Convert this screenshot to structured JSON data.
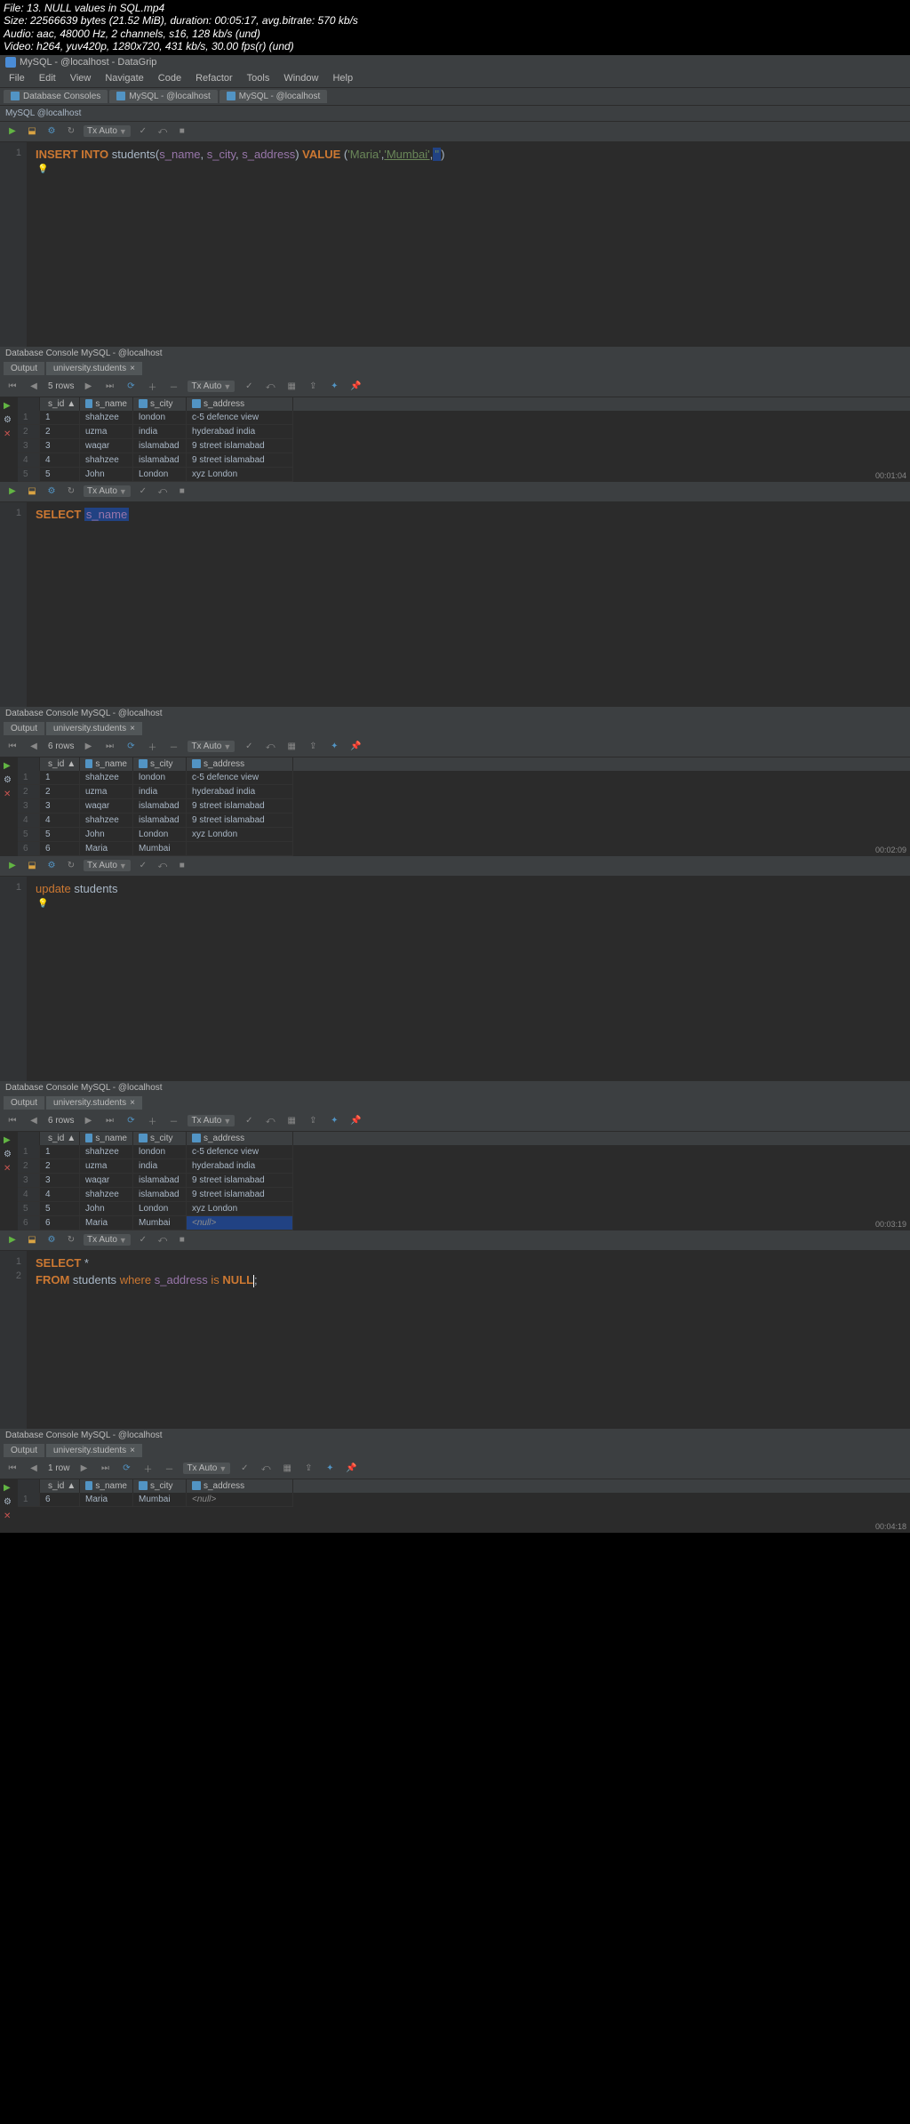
{
  "file_header": {
    "l1": "File: 13. NULL values in SQL.mp4",
    "l2": "Size: 22566639 bytes (21.52 MiB), duration: 00:05:17, avg.bitrate: 570 kb/s",
    "l3": "Audio: aac, 48000 Hz, 2 channels, s16, 128 kb/s (und)",
    "l4": "Video: h264, yuv420p, 1280x720, 431 kb/s, 30.00 fps(r) (und)"
  },
  "app": {
    "title": "MySQL - @localhost - DataGrip"
  },
  "menu": [
    "File",
    "Edit",
    "View",
    "Navigate",
    "Code",
    "Refactor",
    "Tools",
    "Window",
    "Help"
  ],
  "tabs": {
    "t1": "Database Consoles",
    "t2": "MySQL - @localhost",
    "t3": "MySQL - @localhost"
  },
  "breadcrumb": "MySQL  @localhost",
  "txauto": "Tx Auto",
  "frame1": {
    "ln": "1",
    "kw_insert": "INSERT",
    "kw_into": "INTO",
    "table": "students",
    "col1": "s_name",
    "col2": "s_city",
    "col3": "s_address",
    "kw_value": "VALUE",
    "v1": "'Maria'",
    "v2": "'Mumbai'",
    "v3": "''",
    "ts": "00:01:04"
  },
  "console_title": "Database Console MySQL - @localhost",
  "console_tabs": {
    "output": "Output",
    "result": "university.students"
  },
  "cols": {
    "id": "s_id",
    "name": "s_name",
    "city": "s_city",
    "addr": "s_address"
  },
  "result1": {
    "rows_label": "5 rows",
    "rows": [
      {
        "n": "1",
        "id": "1",
        "name": "shahzee",
        "city": "london",
        "addr": "c-5 defence view"
      },
      {
        "n": "2",
        "id": "2",
        "name": "uzma",
        "city": "india",
        "addr": "hyderabad india"
      },
      {
        "n": "3",
        "id": "3",
        "name": "waqar",
        "city": "islamabad",
        "addr": "9 street islamabad"
      },
      {
        "n": "4",
        "id": "4",
        "name": "shahzee",
        "city": "islamabad",
        "addr": "9 street islamabad"
      },
      {
        "n": "5",
        "id": "5",
        "name": "John",
        "city": "London",
        "addr": "xyz London"
      }
    ]
  },
  "frame2": {
    "ln": "1",
    "kw_select": "SELECT",
    "col": "s_name",
    "ts": "00:02:09"
  },
  "result2": {
    "rows_label": "6 rows",
    "rows": [
      {
        "n": "1",
        "id": "1",
        "name": "shahzee",
        "city": "london",
        "addr": "c-5 defence view"
      },
      {
        "n": "2",
        "id": "2",
        "name": "uzma",
        "city": "india",
        "addr": "hyderabad india"
      },
      {
        "n": "3",
        "id": "3",
        "name": "waqar",
        "city": "islamabad",
        "addr": "9 street islamabad"
      },
      {
        "n": "4",
        "id": "4",
        "name": "shahzee",
        "city": "islamabad",
        "addr": "9 street islamabad"
      },
      {
        "n": "5",
        "id": "5",
        "name": "John",
        "city": "London",
        "addr": "xyz London"
      },
      {
        "n": "6",
        "id": "6",
        "name": "Maria",
        "city": "Mumbai",
        "addr": ""
      }
    ]
  },
  "frame3": {
    "ln": "1",
    "kw_update": "update",
    "table": "students",
    "ts": "00:03:19"
  },
  "result3": {
    "rows_label": "6 rows",
    "rows": [
      {
        "n": "1",
        "id": "1",
        "name": "shahzee",
        "city": "london",
        "addr": "c-5 defence view"
      },
      {
        "n": "2",
        "id": "2",
        "name": "uzma",
        "city": "india",
        "addr": "hyderabad india"
      },
      {
        "n": "3",
        "id": "3",
        "name": "waqar",
        "city": "islamabad",
        "addr": "9 street islamabad"
      },
      {
        "n": "4",
        "id": "4",
        "name": "shahzee",
        "city": "islamabad",
        "addr": "9 street islamabad"
      },
      {
        "n": "5",
        "id": "5",
        "name": "John",
        "city": "London",
        "addr": "xyz London"
      },
      {
        "n": "6",
        "id": "6",
        "name": "Maria",
        "city": "Mumbai",
        "addr": "<null>"
      }
    ]
  },
  "frame4": {
    "ln1": "1",
    "ln2": "2",
    "kw_select": "SELECT",
    "star": "*",
    "kw_from": "FROM",
    "table": "students",
    "kw_where": "where",
    "col": "s_address",
    "kw_is": "is",
    "kw_null": "NULL",
    "semi": ";",
    "ts": "00:04:18"
  },
  "result4": {
    "rows_label": "1 row",
    "rows": [
      {
        "n": "1",
        "id": "6",
        "name": "Maria",
        "city": "Mumbai",
        "addr": "<null>"
      }
    ]
  }
}
